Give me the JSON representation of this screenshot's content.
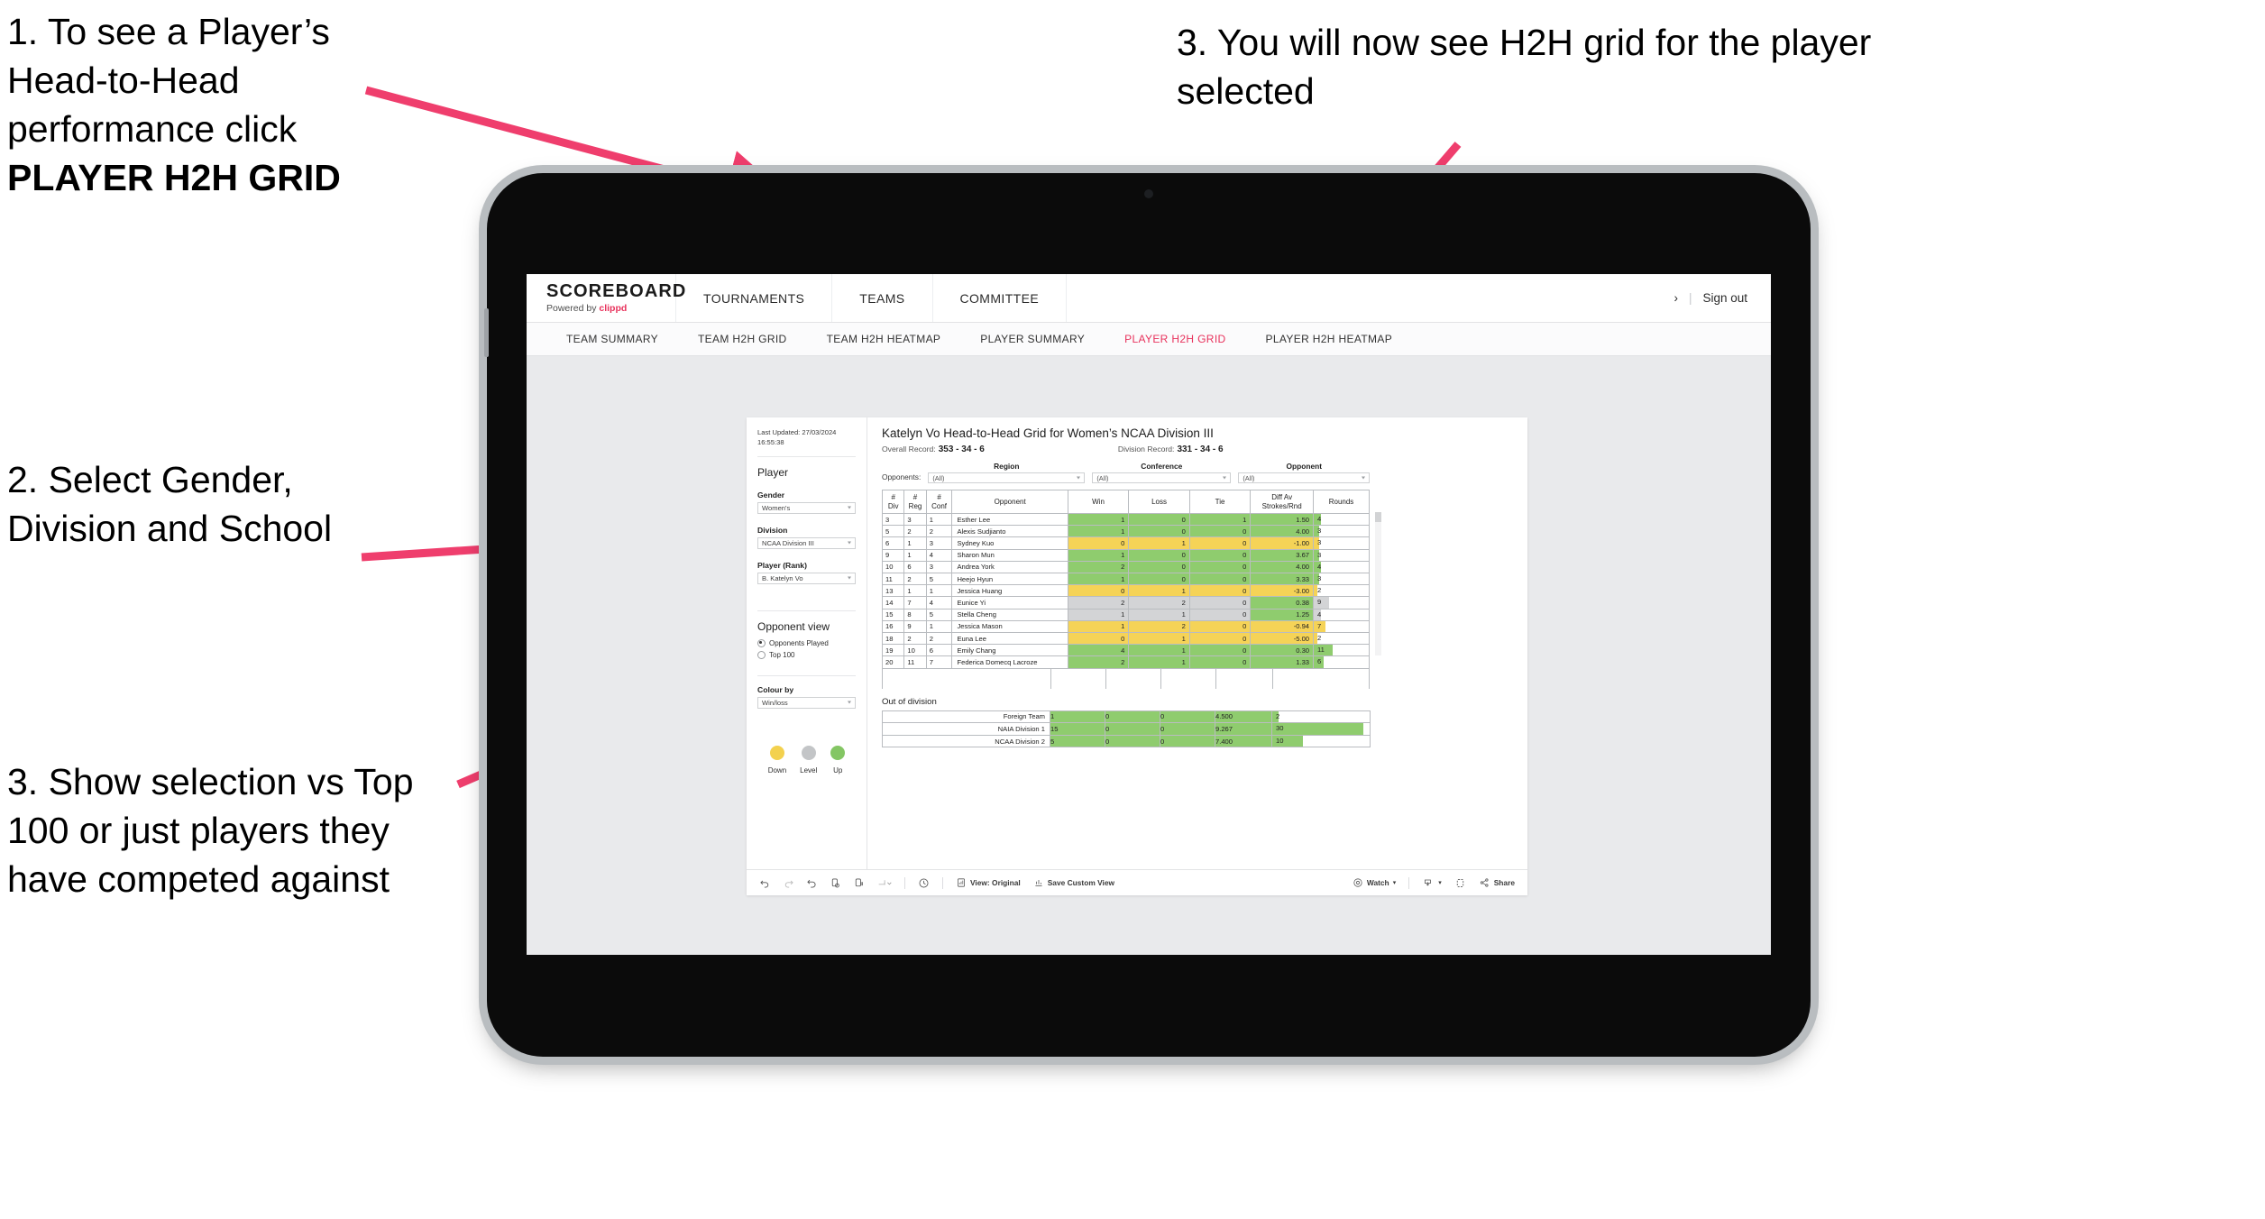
{
  "annotations": {
    "c1_a": "1. To see a Player’s Head-to-Head performance click ",
    "c1_b": "PLAYER H2H GRID",
    "c2": "2. Select Gender, Division and School",
    "c3": "3. Show selection vs Top 100 or just players they have competed against",
    "c4": "3. You will now see H2H grid for the player selected",
    "arrow_color": "#ef3e6d"
  },
  "app": {
    "brand": {
      "name": "SCOREBOARD",
      "powered_prefix": "Powered by ",
      "powered_brand": "clippd"
    },
    "topnav": [
      {
        "label": "TOURNAMENTS"
      },
      {
        "label": "TEAMS"
      },
      {
        "label": "COMMITTEE"
      }
    ],
    "account": {
      "chevron": "›",
      "separator": "|",
      "signout": "Sign out"
    },
    "subnav": [
      {
        "label": "TEAM SUMMARY",
        "active": false
      },
      {
        "label": "TEAM H2H GRID",
        "active": false
      },
      {
        "label": "TEAM H2H HEATMAP",
        "active": false
      },
      {
        "label": "PLAYER SUMMARY",
        "active": false
      },
      {
        "label": "PLAYER H2H GRID",
        "active": true
      },
      {
        "label": "PLAYER H2H HEATMAP",
        "active": false
      }
    ],
    "accent_color": "#e8325c"
  },
  "sidebar": {
    "last_updated": "Last Updated: 27/03/2024 16:55:38",
    "player_heading": "Player",
    "gender": {
      "label": "Gender",
      "value": "Women's"
    },
    "division": {
      "label": "Division",
      "value": "NCAA Division III"
    },
    "player_rank": {
      "label": "Player (Rank)",
      "value": "B. Katelyn Vo"
    },
    "opponent_view": {
      "heading": "Opponent view",
      "options": [
        {
          "label": "Opponents Played",
          "selected": true
        },
        {
          "label": "Top 100",
          "selected": false
        }
      ]
    },
    "colour_by": {
      "label": "Colour by",
      "value": "Win/loss"
    },
    "legend": [
      {
        "label": "Down",
        "color": "#f3d14e"
      },
      {
        "label": "Level",
        "color": "#c3c5c7"
      },
      {
        "label": "Up",
        "color": "#84c664"
      }
    ]
  },
  "report": {
    "title": "Katelyn Vo Head-to-Head Grid for Women’s NCAA Division III",
    "overall_record": {
      "label": "Overall Record:",
      "value": "353 -  34 - 6"
    },
    "division_record": {
      "label": "Division Record:",
      "value": "331 -  34 - 6"
    },
    "opponents_label": "Opponents:",
    "filters": [
      {
        "name": "Region",
        "value": "(All)"
      },
      {
        "name": "Conference",
        "value": "(All)"
      },
      {
        "name": "Opponent",
        "value": "(All)"
      }
    ],
    "out_of_division_title": "Out of division"
  },
  "chart_data": {
    "type": "table",
    "title": "Katelyn Vo Head-to-Head Grid for Women’s NCAA Division III",
    "columns": [
      "# Div",
      "# Reg",
      "# Conf",
      "Opponent",
      "Win",
      "Loss",
      "Tie",
      "Diff Av Strokes/Rnd",
      "Rounds"
    ],
    "column_headers_lines": [
      [
        "#",
        "Div"
      ],
      [
        "#",
        "Reg"
      ],
      [
        "#",
        "Conf"
      ],
      [
        "Opponent"
      ],
      [
        "Win"
      ],
      [
        "Loss"
      ],
      [
        "Tie"
      ],
      [
        "Diff Av",
        "Strokes/Rnd"
      ],
      [
        "Rounds"
      ]
    ],
    "rounds_max": 32,
    "rows": [
      {
        "div": "3",
        "reg": "3",
        "conf": "1",
        "opponent": "Esther Lee",
        "win": "1",
        "loss": "0",
        "tie": "1",
        "diff": "1.50",
        "rounds": "4",
        "state": "up"
      },
      {
        "div": "5",
        "reg": "2",
        "conf": "2",
        "opponent": "Alexis Sudjianto",
        "win": "1",
        "loss": "0",
        "tie": "0",
        "diff": "4.00",
        "rounds": "3",
        "state": "up"
      },
      {
        "div": "6",
        "reg": "1",
        "conf": "3",
        "opponent": "Sydney Kuo",
        "win": "0",
        "loss": "1",
        "tie": "0",
        "diff": "-1.00",
        "rounds": "3",
        "state": "down"
      },
      {
        "div": "9",
        "reg": "1",
        "conf": "4",
        "opponent": "Sharon Mun",
        "win": "1",
        "loss": "0",
        "tie": "0",
        "diff": "3.67",
        "rounds": "3",
        "state": "up"
      },
      {
        "div": "10",
        "reg": "6",
        "conf": "3",
        "opponent": "Andrea York",
        "win": "2",
        "loss": "0",
        "tie": "0",
        "diff": "4.00",
        "rounds": "4",
        "state": "up"
      },
      {
        "div": "11",
        "reg": "2",
        "conf": "5",
        "opponent": "Heejo Hyun",
        "win": "1",
        "loss": "0",
        "tie": "0",
        "diff": "3.33",
        "rounds": "3",
        "state": "up"
      },
      {
        "div": "13",
        "reg": "1",
        "conf": "1",
        "opponent": "Jessica Huang",
        "win": "0",
        "loss": "1",
        "tie": "0",
        "diff": "-3.00",
        "rounds": "2",
        "state": "down"
      },
      {
        "div": "14",
        "reg": "7",
        "conf": "4",
        "opponent": "Eunice Yi",
        "win": "2",
        "loss": "2",
        "tie": "0",
        "diff": "0.38",
        "rounds": "9",
        "state": "level",
        "diff_state": "up"
      },
      {
        "div": "15",
        "reg": "8",
        "conf": "5",
        "opponent": "Stella Cheng",
        "win": "1",
        "loss": "1",
        "tie": "0",
        "diff": "1.25",
        "rounds": "4",
        "state": "level",
        "diff_state": "up"
      },
      {
        "div": "16",
        "reg": "9",
        "conf": "1",
        "opponent": "Jessica Mason",
        "win": "1",
        "loss": "2",
        "tie": "0",
        "diff": "-0.94",
        "rounds": "7",
        "state": "down"
      },
      {
        "div": "18",
        "reg": "2",
        "conf": "2",
        "opponent": "Euna Lee",
        "win": "0",
        "loss": "1",
        "tie": "0",
        "diff": "-5.00",
        "rounds": "2",
        "state": "down"
      },
      {
        "div": "19",
        "reg": "10",
        "conf": "6",
        "opponent": "Emily Chang",
        "win": "4",
        "loss": "1",
        "tie": "0",
        "diff": "0.30",
        "rounds": "11",
        "state": "up"
      },
      {
        "div": "20",
        "reg": "11",
        "conf": "7",
        "opponent": "Federica Domecq Lacroze",
        "win": "2",
        "loss": "1",
        "tie": "0",
        "diff": "1.33",
        "rounds": "6",
        "state": "up"
      }
    ],
    "out_of_division_rows": [
      {
        "name": "Foreign Team",
        "win": "1",
        "loss": "0",
        "tie": "0",
        "diff": "4.500",
        "rounds": "2",
        "state": "up"
      },
      {
        "name": "NAIA Division 1",
        "win": "15",
        "loss": "0",
        "tie": "0",
        "diff": "9.267",
        "rounds": "30",
        "state": "up"
      },
      {
        "name": "NCAA Division 2",
        "win": "5",
        "loss": "0",
        "tie": "0",
        "diff": "7.400",
        "rounds": "10",
        "state": "up"
      }
    ],
    "colors": {
      "up": "#8fcc6e",
      "down": "#f5d357",
      "level": "#d3d4d6"
    }
  },
  "toolbar": {
    "undo": "undo-icon",
    "redo": "redo-icon",
    "revert": "revert-icon",
    "refresh": "refresh-data-icon",
    "pause": "pause-icon",
    "forward": "forward-icon",
    "history": "history-icon",
    "view_label": "View: Original",
    "save_label": "Save Custom View",
    "watch_label": "Watch",
    "download_label": "download-icon",
    "fullscreen_label": "fullscreen-icon",
    "share_label": "Share"
  }
}
